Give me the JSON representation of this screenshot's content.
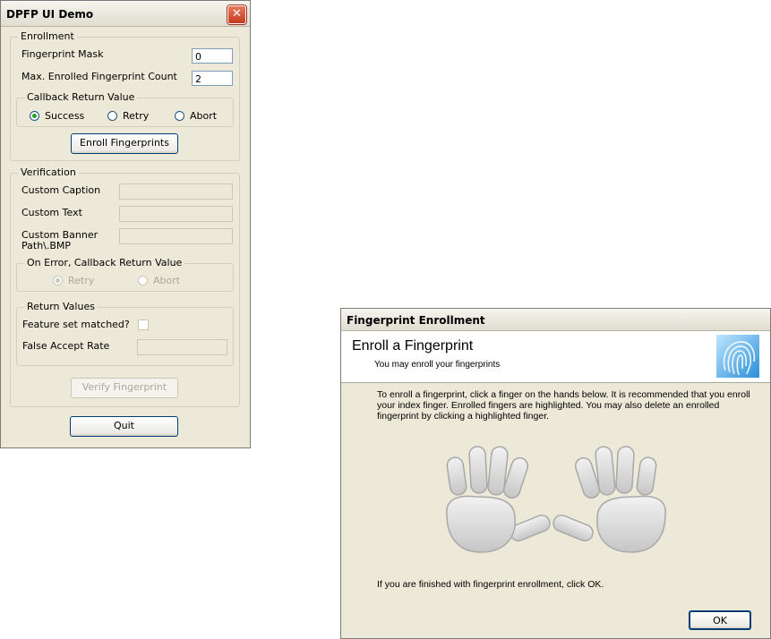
{
  "demo_window": {
    "title": "DPFP UI Demo",
    "close_glyph": "✕",
    "enrollment": {
      "legend": "Enrollment",
      "mask_label": "Fingerprint Mask",
      "mask_value": "0",
      "max_label": "Max. Enrolled Fingerprint Count",
      "max_value": "2",
      "callback": {
        "legend": "Callback Return Value",
        "options": [
          "Success",
          "Retry",
          "Abort"
        ],
        "selected": "Success"
      },
      "enroll_button": "Enroll Fingerprints"
    },
    "verification": {
      "legend": "Verification",
      "caption_label": "Custom Caption",
      "text_label": "Custom Text",
      "banner_label_line1": "Custom Banner",
      "banner_label_line2": "Path\\.BMP",
      "on_error": {
        "legend": "On Error, Callback Return Value",
        "options": [
          "Retry",
          "Abort"
        ],
        "selected": "Retry"
      },
      "return_values": {
        "legend": "Return Values",
        "matched_label": "Feature set matched?",
        "far_label": "False Accept Rate"
      },
      "verify_button": "Verify Fingerprint"
    },
    "quit_button": "Quit"
  },
  "enroll_window": {
    "title": "Fingerprint Enrollment",
    "header_title": "Enroll a Fingerprint",
    "header_subtitle": "You may enroll your fingerprints",
    "instructions": "To enroll a fingerprint, click a finger on the hands below. It is recommended that you enroll your index finger. Enrolled fingers are highlighted. You may also delete an enrolled fingerprint by clicking a highlighted finger.",
    "finish_text": "If you are finished with fingerprint enrollment, click OK.",
    "ok_button": "OK",
    "icon": "fingerprint-icon"
  },
  "colors": {
    "dialog_bg": "#ece9d8",
    "button_border": "#003c74",
    "radio_dot": "#21a121",
    "disabled_text": "#aca899",
    "hand_fill": "#d8d8d8"
  }
}
